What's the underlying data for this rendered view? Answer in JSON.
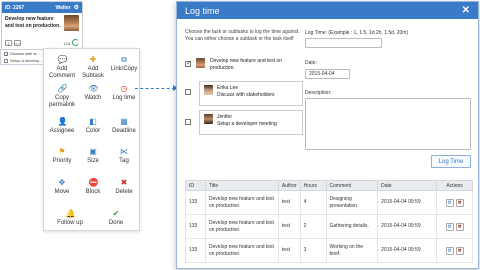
{
  "card": {
    "id": "ID: 2267",
    "user": "Walter",
    "title": "Develop new feature and test on production.",
    "count": "12d",
    "expand_label": "<>",
    "subtasks": [
      "Discuss with st...",
      "Setup a develop..."
    ]
  },
  "menu": {
    "items": [
      {
        "label": "Add Comment",
        "icon": "comment-icon"
      },
      {
        "label": "Add Subtask",
        "icon": "plus-icon"
      },
      {
        "label": "Link/Copy",
        "icon": "link-icon"
      },
      {
        "label": "Copy permalink",
        "icon": "permalink-icon"
      },
      {
        "label": "Watch",
        "icon": "eye-icon"
      },
      {
        "label": "Log time",
        "icon": "clock-icon"
      },
      {
        "label": "Assignee",
        "icon": "user-icon"
      },
      {
        "label": "Color",
        "icon": "palette-icon"
      },
      {
        "label": "Deadline",
        "icon": "calendar-icon"
      },
      {
        "label": "Priority",
        "icon": "flag-icon"
      },
      {
        "label": "Size",
        "icon": "size-icon"
      },
      {
        "label": "Tag",
        "icon": "tag-icon"
      },
      {
        "label": "Move",
        "icon": "move-icon"
      },
      {
        "label": "Block",
        "icon": "block-icon"
      },
      {
        "label": "Delete",
        "icon": "close-icon"
      },
      {
        "label": "Follow up",
        "icon": "bell-icon"
      },
      {
        "label": "Done",
        "icon": "check-icon"
      }
    ]
  },
  "dialog": {
    "title": "Log time",
    "close": "✕",
    "intro": "Choose the task or subtasks to log the time against. You can either choose a subtask or the task itself",
    "main_task": "Develop new feature and test on production.",
    "subtasks": [
      {
        "assignee": "Erika Lee",
        "title": "Discuss with stakeholders"
      },
      {
        "assignee": "Jenifer",
        "title": "Setup a developer meeting"
      }
    ],
    "log_time_label": "Log Time: (Example : 1, 1.5, 1d 2h, 1.5d, 20m)",
    "log_time_value": "",
    "date_label": "Date:",
    "date_value": "2015-04-04",
    "description_label": "Description:",
    "submit_label": "Log Time",
    "table": {
      "headers": [
        "ID",
        "Title",
        "Author",
        "Hours",
        "Comment",
        "Date",
        "Actions"
      ],
      "rows": [
        [
          "133",
          "Develop new feature and test on production.",
          "test",
          "4",
          "Designing presentation.",
          "2015-04-04 09:59"
        ],
        [
          "133",
          "Develop new feature and test on production.",
          "test",
          "2",
          "Gathering details.",
          "2015-04-04 09:59"
        ],
        [
          "133",
          "Develop new feature and test on production.",
          "test",
          "3",
          "Working on the brief.",
          "2015-04-04 09:59"
        ]
      ]
    }
  },
  "colors": {
    "accent": "#3a7bc8",
    "danger": "#c0392b",
    "warning": "#e6a01e",
    "success": "#3a9b4f"
  }
}
